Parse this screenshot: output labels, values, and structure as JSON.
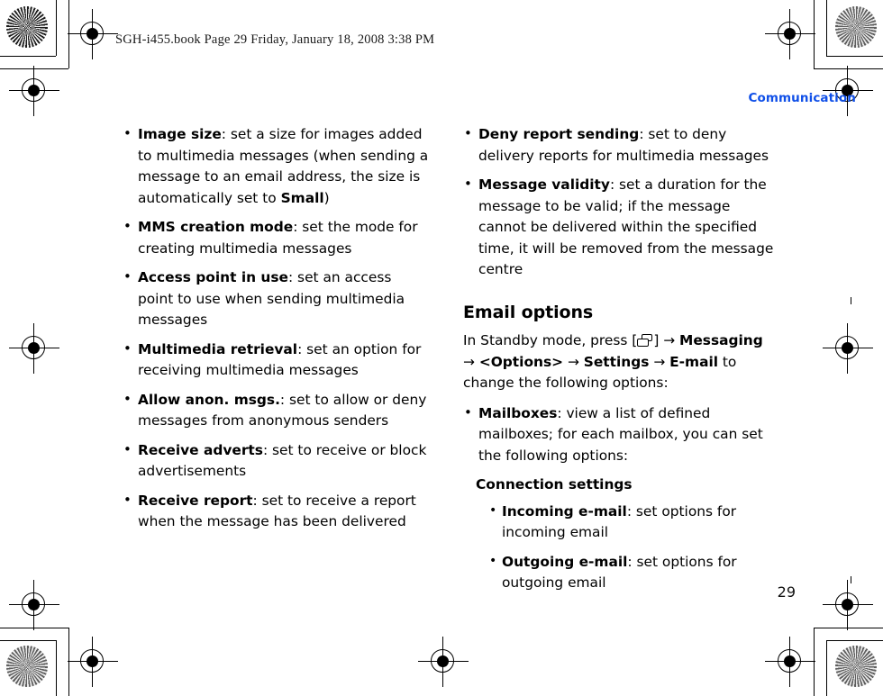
{
  "document": {
    "file_line": "SGH-i455.book  Page 29  Friday, January 18, 2008  3:38 PM",
    "running_head": "Communication",
    "page_number": "29",
    "accent_color": "#0f4fe8"
  },
  "left_column": {
    "bullets": [
      {
        "term": "Image size",
        "sep": ": ",
        "text_before_bold": "set a size for images added to multimedia messages (when sending a message to an email address, the size is automatically set to ",
        "inline_bold": "Small",
        "text_after_bold": ")"
      },
      {
        "term": "MMS creation mode",
        "sep": ": ",
        "text_before_bold": "set the mode for creating multimedia messages",
        "inline_bold": "",
        "text_after_bold": ""
      },
      {
        "term": "Access point in use",
        "sep": ": ",
        "text_before_bold": "set an access point to use when sending multimedia messages",
        "inline_bold": "",
        "text_after_bold": ""
      },
      {
        "term": "Multimedia retrieval",
        "sep": ": ",
        "text_before_bold": "set an option for receiving multimedia messages",
        "inline_bold": "",
        "text_after_bold": ""
      },
      {
        "term": "Allow anon. msgs.",
        "sep": ": ",
        "text_before_bold": "set to allow or deny messages from anonymous senders",
        "inline_bold": "",
        "text_after_bold": ""
      },
      {
        "term": "Receive adverts",
        "sep": ": ",
        "text_before_bold": "set to receive or block advertisements",
        "inline_bold": "",
        "text_after_bold": ""
      },
      {
        "term": "Receive report",
        "sep": ": ",
        "text_before_bold": "set to receive a report when the message has been delivered",
        "inline_bold": "",
        "text_after_bold": ""
      }
    ]
  },
  "right_column": {
    "bullets_top": [
      {
        "term": "Deny report sending",
        "sep": ": ",
        "text": "set to deny delivery reports for multimedia messages"
      },
      {
        "term": "Message validity",
        "sep": ": ",
        "text": "set a duration for the message to be valid; if the message cannot be delivered within the specified time, it will be removed from the message centre"
      }
    ],
    "section": {
      "heading": "Email options",
      "path_lead": "In Standby mode, press [",
      "path_icon": "menu-key-icon",
      "path_after_icon": "] ",
      "arrow": "→",
      "step_1": "Messaging",
      "step_2": "<Options>",
      "step_3": "Settings",
      "step_4": "E-mail",
      "path_tail": " to change the following options:"
    },
    "bullets_bottom": [
      {
        "term": "Mailboxes",
        "sep": ": ",
        "text": "view a list of defined mailboxes; for each mailbox, you can set the following options:"
      }
    ],
    "subheading": "Connection settings",
    "nested_bullets": [
      {
        "term": "Incoming e-mail",
        "sep": ": ",
        "text": "set options for incoming email"
      },
      {
        "term": "Outgoing e-mail",
        "sep": ": ",
        "text": "set options for outgoing email"
      }
    ]
  }
}
